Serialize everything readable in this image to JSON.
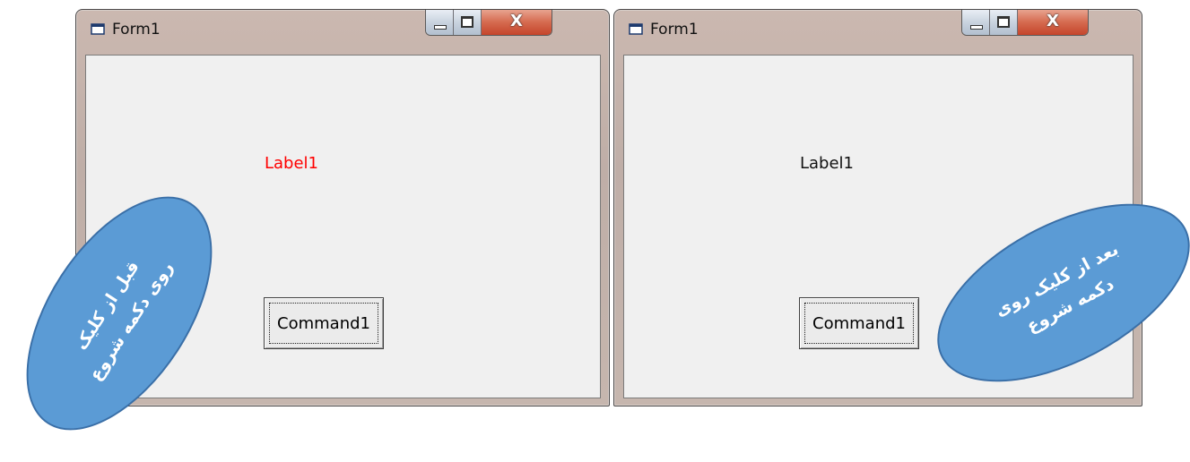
{
  "windows": [
    {
      "title": "Form1",
      "label": "Label1",
      "label_color": "#ff0000",
      "command_label": "Command1",
      "caption_buttons": {
        "minimize_icon": "minimize-icon",
        "maximize_icon": "maximize-icon",
        "close_label": "X"
      }
    },
    {
      "title": "Form1",
      "label": "Label1",
      "label_color": "#111111",
      "command_label": "Command1",
      "caption_buttons": {
        "minimize_icon": "minimize-icon",
        "maximize_icon": "maximize-icon",
        "close_label": "X"
      }
    }
  ],
  "callouts": {
    "before_text": "قبل از کلیک\nروی دکمه شروع",
    "after_text": "بعد از کلیک روی\nدکمه شروع",
    "color": "#5b9bd5"
  }
}
